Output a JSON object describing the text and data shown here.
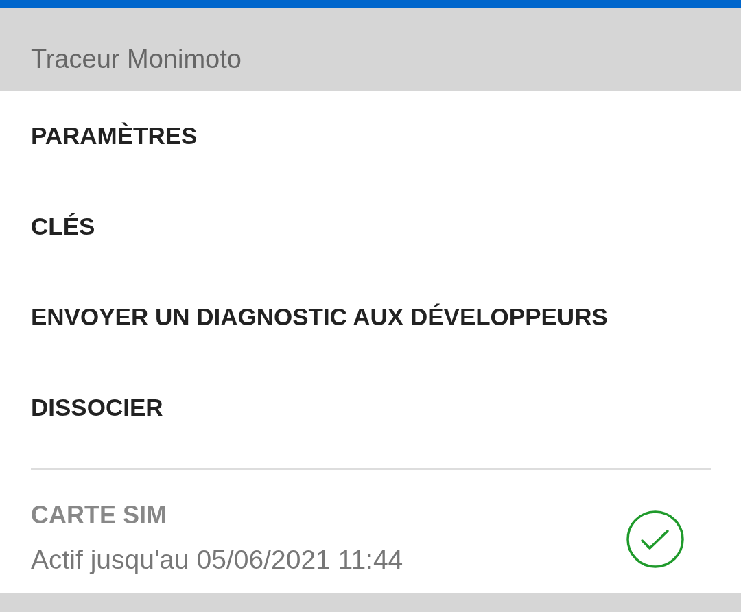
{
  "header": {
    "title": "Traceur Monimoto"
  },
  "menu": [
    {
      "label": "PARAMÈTRES"
    },
    {
      "label": "CLÉS"
    },
    {
      "label": "ENVOYER UN DIAGNOSTIC AUX DÉVELOPPEURS"
    },
    {
      "label": "DISSOCIER"
    }
  ],
  "sim_card": {
    "title": "CARTE SIM",
    "status_text": "Actif jusqu'au 05/06/2021 11:44",
    "active": true
  }
}
